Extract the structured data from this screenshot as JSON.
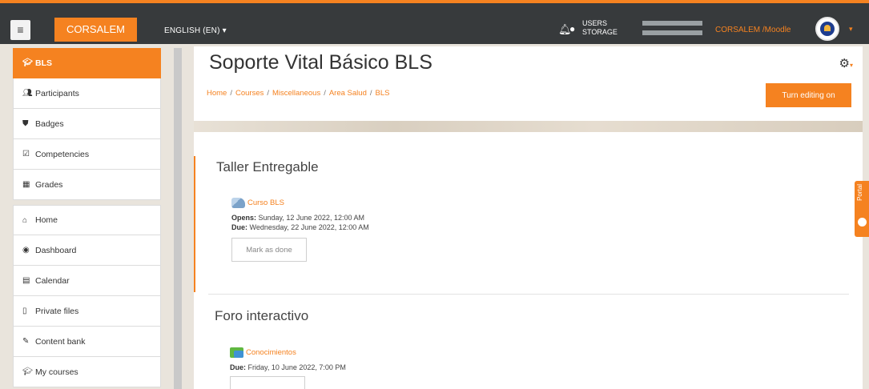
{
  "header": {
    "menu_icon": "hamburger-icon",
    "brand": "CORSALEM",
    "language": "ENGLISH (EN) ▾",
    "quota_users": "USERS",
    "quota_storage": "STORAGE",
    "user": "CORSALEM /Moodle",
    "avatar_caret": "▾"
  },
  "sidebar": {
    "items": [
      {
        "label": "BLS",
        "icon": "graduation-cap-icon"
      },
      {
        "label": "Participants",
        "icon": "users-icon"
      },
      {
        "label": "Badges",
        "icon": "shield-icon"
      },
      {
        "label": "Competencies",
        "icon": "check-square-icon"
      },
      {
        "label": "Grades",
        "icon": "table-icon"
      },
      {
        "label": "Home",
        "icon": "home-icon"
      },
      {
        "label": "Dashboard",
        "icon": "dashboard-icon"
      },
      {
        "label": "Calendar",
        "icon": "calendar-icon"
      },
      {
        "label": "Private files",
        "icon": "file-icon"
      },
      {
        "label": "Content bank",
        "icon": "brush-icon"
      },
      {
        "label": "My courses",
        "icon": "graduation-cap-icon"
      }
    ]
  },
  "course": {
    "title": "Soporte Vital Básico BLS",
    "breadcrumb": [
      "Home",
      "Courses",
      "Miscellaneous",
      "Area Salud",
      "BLS"
    ],
    "breadcrumb_sep": "/",
    "edit_button": "Turn editing on"
  },
  "sections": [
    {
      "title": "Taller Entregable",
      "activity": {
        "name": "Curso BLS",
        "opens_label": "Opens:",
        "opens": "Sunday, 12 June 2022, 12:00 AM",
        "due_label": "Due:",
        "due": "Wednesday, 22 June 2022, 12:00 AM",
        "button": "Mark as done"
      }
    },
    {
      "title": "Foro interactivo",
      "activity": {
        "name": "Conocimientos",
        "due_label": "Due:",
        "due": "Friday, 10 June 2022, 7:00 PM"
      }
    }
  ],
  "portal": {
    "label": "Portal"
  },
  "colors": {
    "accent": "#f58220",
    "topbar": "#373a3c"
  }
}
